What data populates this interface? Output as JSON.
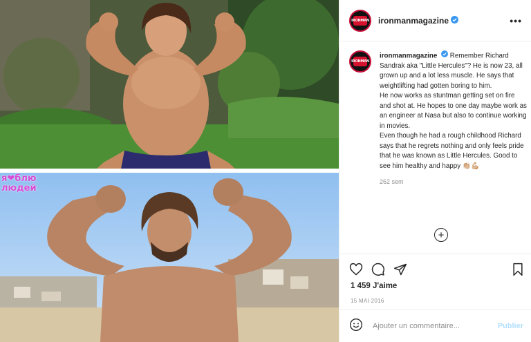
{
  "media": {
    "watermark_line1": "я❤блю",
    "watermark_line2": "людей"
  },
  "post": {
    "username": "ironmanmagazine",
    "avatar_text": "IRONMAN",
    "more_label": "•••",
    "caption": {
      "username": "ironmanmagazine",
      "lines": [
        "Remember Richard Sandrak aka \"Little Hercules\"? He is now 23, all grown up and a lot less muscle. He says that weightlifting had gotten boring to him.",
        "He now works as stuntman getting set on fire and shot at. He hopes to one day maybe work as an engineer at Nasa but also to continue working in movies.",
        "Even though he had a rough childhood Richard says that he regrets nothing and only feels pride that he was known as Little Hercules. Good to see him healthy and happy 👏🏼💪🏼"
      ],
      "time": "262 sem"
    },
    "likes": "1 459 J'aime",
    "date": "15 MAI 2016",
    "comment_placeholder": "Ajouter un commentaire...",
    "publish_label": "Publier"
  },
  "icons": {
    "like": "heart-icon",
    "comment": "comment-icon",
    "share": "share-icon",
    "save": "bookmark-icon",
    "emoji": "emoji-icon",
    "load_more": "plus-circle-icon"
  },
  "colors": {
    "accent_blue": "#0095f6",
    "verified_blue": "#3897f0",
    "muted_text": "#8e8e8e",
    "publish_disabled": "#b2dffc"
  }
}
